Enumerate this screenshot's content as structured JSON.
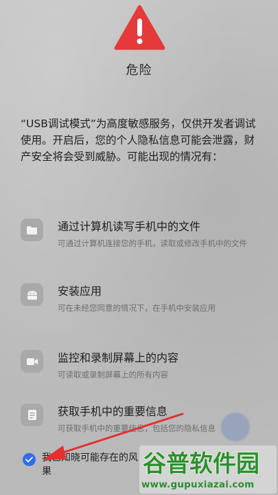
{
  "dialog": {
    "title": "危险",
    "description": "“USB调试模式”为高度敏感服务，仅供开发者调试使用。开启后，您的个人隐私信息可能会泄露，财产安全将会受到威胁。可能出现的情况有："
  },
  "risks": [
    {
      "icon": "folder-icon",
      "title": "通过计算机读写手机中的文件",
      "subtitle": "可通过计算机连接您的手机，读取或修改手机中的文件"
    },
    {
      "icon": "android-icon",
      "title": "安装应用",
      "subtitle": "可在未经您同意的情况下，在手机中安装应用"
    },
    {
      "icon": "video-camera-icon",
      "title": "监控和录制屏幕上的内容",
      "subtitle": "可读取或录制屏幕上的所有内容"
    },
    {
      "icon": "document-icon",
      "title": "获取手机中的重要信息",
      "subtitle": "可获取手机中的重要信息，包括您的隐私信息"
    }
  ],
  "agreement": {
    "checked": true,
    "text_line1": "我已知晓可能存在的风",
    "text_line2": "果"
  },
  "watermark": {
    "brand": "谷普软件园",
    "url": "www.gupuxiazai.com"
  },
  "colors": {
    "warning_red": "#e43a3a",
    "checkbox_blue": "#2f6cf0",
    "annotation_arrow": "#e53030",
    "watermark_green": "#2d8f2d"
  }
}
